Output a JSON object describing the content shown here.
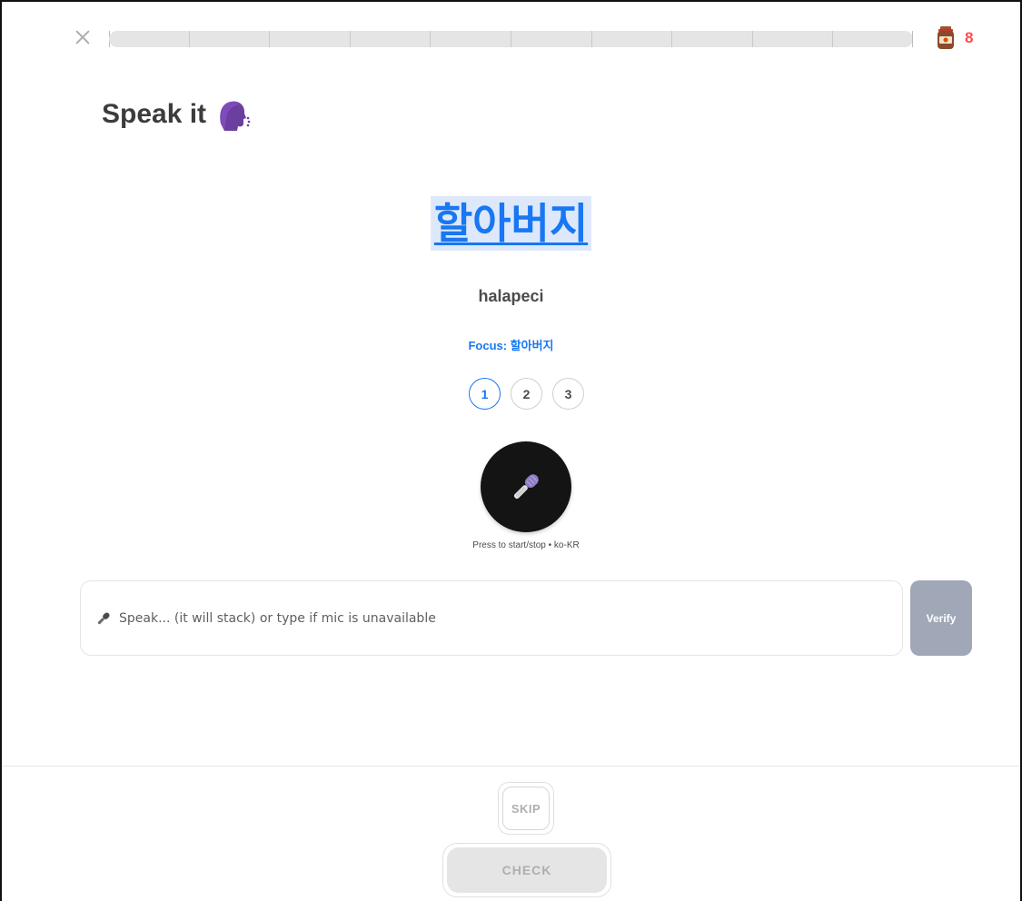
{
  "header": {
    "progress_fraction": 0,
    "progress_segments": 10,
    "lives": "8",
    "lives_icon": "jar-icon"
  },
  "exercise": {
    "title": "Speak it",
    "title_icon": "speaking-head-icon",
    "word": "할아버지",
    "romanization": "halapeci",
    "focus_label": "Focus: 할아버지",
    "steps": [
      "1",
      "2",
      "3"
    ],
    "active_step": "1",
    "mic_caption": "Press to start/stop • ko-KR",
    "mic_icon": "microphone-icon"
  },
  "answer": {
    "value": "",
    "placeholder": "Speak... (it will stack) or type if mic is unavailable",
    "verify_label": "Verify"
  },
  "footer": {
    "skip_label": "SKIP",
    "check_label": "CHECK"
  },
  "colors": {
    "accent_blue": "#1877f2",
    "lives_red": "#ff4b4b",
    "verify_bg": "#a0a8b8",
    "mic_bg": "#141414"
  }
}
